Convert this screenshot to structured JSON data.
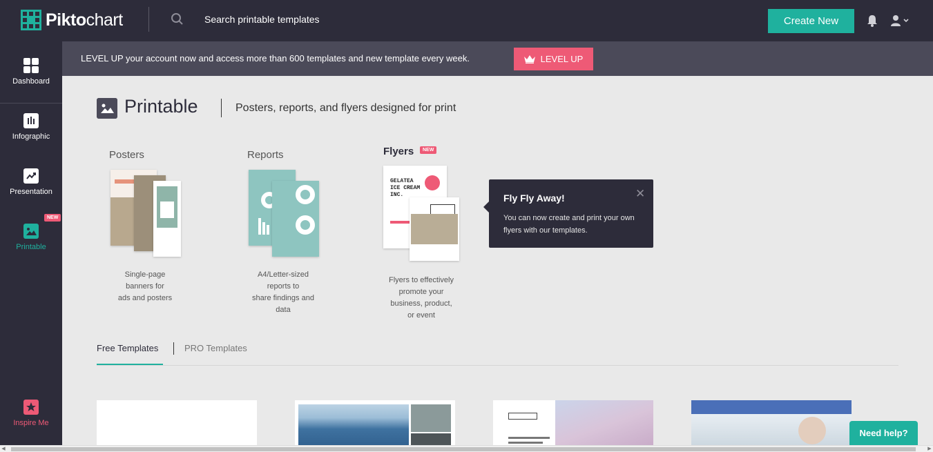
{
  "topbar": {
    "logo_text_bold": "Pikto",
    "logo_text_rest": "chart",
    "search_placeholder": "Search printable templates",
    "create_label": "Create New"
  },
  "sidebar": {
    "items": [
      {
        "label": "Dashboard",
        "icon": "grid-icon"
      },
      {
        "label": "Infographic",
        "icon": "bar-chart-icon"
      },
      {
        "label": "Presentation",
        "icon": "trend-icon"
      },
      {
        "label": "Printable",
        "icon": "image-icon",
        "badge": "NEW"
      },
      {
        "label": "Inspire Me",
        "icon": "star-icon"
      }
    ]
  },
  "banner": {
    "text": "LEVEL UP your account now and access more than 600 templates and new template every week.",
    "button_label": "LEVEL UP"
  },
  "header": {
    "title": "Printable",
    "subtitle": "Posters, reports, and flyers designed for print"
  },
  "categories": [
    {
      "label": "Posters",
      "desc": [
        "Single-page",
        "banners for",
        "ads and posters"
      ]
    },
    {
      "label": "Reports",
      "desc": [
        "A4/Letter-sized",
        "reports to",
        "share findings and",
        "data"
      ]
    },
    {
      "label": "Flyers",
      "badge": "NEW",
      "desc": [
        "Flyers to effectively",
        "promote your",
        "business, product,",
        "or event"
      ]
    }
  ],
  "flyer_thumb_text": "GELATEA ICE CREAM INC.",
  "tooltip": {
    "title": "Fly Fly Away!",
    "body": "You can now create and print your own flyers with our templates."
  },
  "tabs": {
    "free": "Free Templates",
    "pro": "PRO Templates"
  },
  "help_label": "Need help?",
  "colors": {
    "accent": "#1fb19e",
    "pink": "#ee5a76",
    "dark": "#2d2c3a"
  }
}
